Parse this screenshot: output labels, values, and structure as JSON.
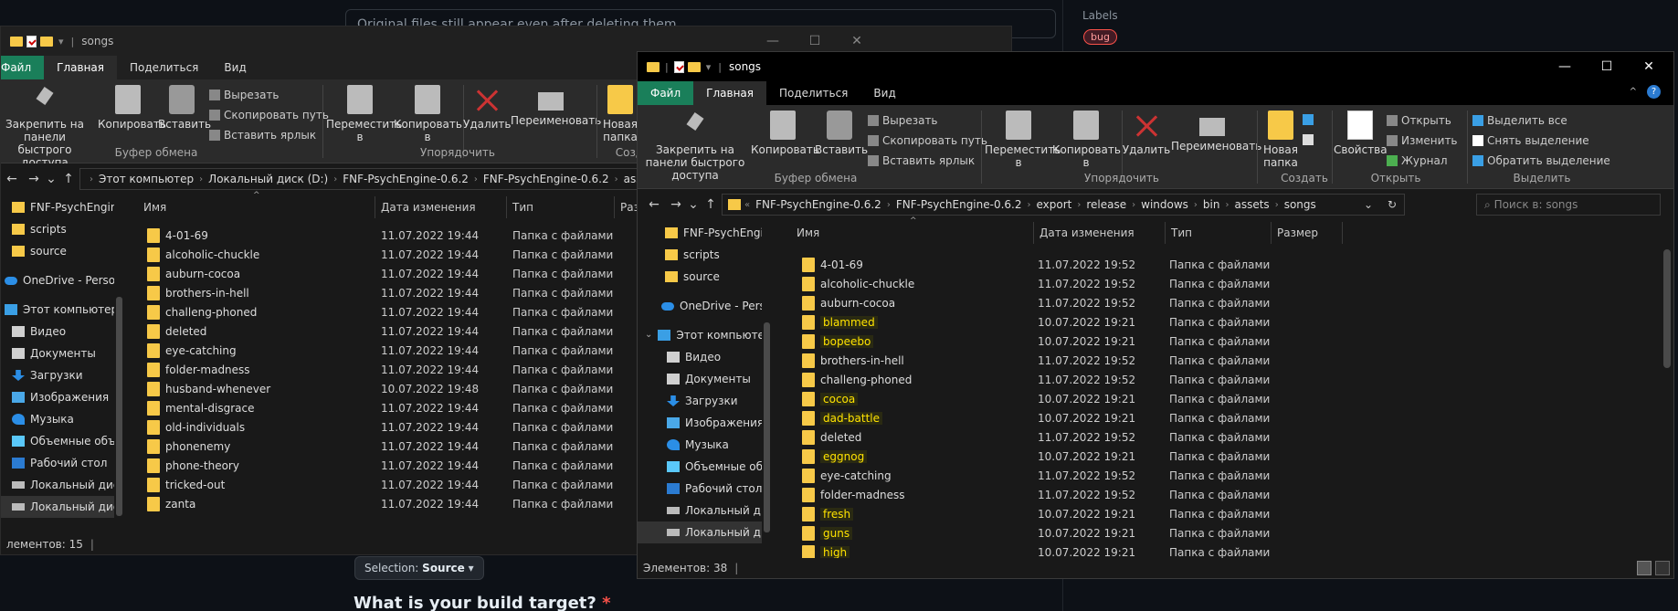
{
  "github": {
    "title_text": "Original files still appear even after deleting them",
    "labels_heading": "Labels",
    "bug_label": "bug",
    "selection_prefix": "Selection:",
    "selection_value": "Source",
    "question_text": "What is your build target?",
    "required_marker": "*"
  },
  "window1": {
    "title": "songs",
    "tabs": [
      "Файл",
      "Главная",
      "Поделиться",
      "Вид"
    ],
    "ribbon": {
      "pin_label": "Закрепить на панели быстрого доступа",
      "copy_label": "Копировать",
      "paste_label": "Вставить",
      "cut_label": "Вырезать",
      "copy_path_label": "Скопировать путь",
      "paste_shortcut_label": "Вставить ярлык",
      "clipboard_group": "Буфер обмена",
      "move_to_label": "Переместить в",
      "copy_to_label": "Копировать в",
      "delete_label": "Удалить",
      "rename_label": "Переименовать",
      "organize_group": "Упорядочить",
      "new_folder_label": "Новая папка",
      "create_group": "Созд"
    },
    "breadcrumbs": [
      "Этот компьютер",
      "Локальный диск (D:)",
      "FNF-PsychEngine-0.6.2",
      "FNF-PsychEngine-0.6.2",
      "assets"
    ],
    "nav_items": [
      "FNF-PsychEngin",
      "scripts",
      "source",
      "OneDrive - Persor",
      "Этот компьютер",
      "Видео",
      "Документы",
      "Загрузки",
      "Изображения",
      "Музыка",
      "Объемные объ",
      "Рабочий стол",
      "Локальный дис",
      "Локальный дис"
    ],
    "columns": [
      "Имя",
      "Дата изменения",
      "Тип",
      "Раз"
    ],
    "rows": [
      {
        "name": "4-01-69",
        "date": "11.07.2022 19:44",
        "type": "Папка с файлами"
      },
      {
        "name": "alcoholic-chuckle",
        "date": "11.07.2022 19:44",
        "type": "Папка с файлами"
      },
      {
        "name": "auburn-cocoa",
        "date": "11.07.2022 19:44",
        "type": "Папка с файлами"
      },
      {
        "name": "brothers-in-hell",
        "date": "11.07.2022 19:44",
        "type": "Папка с файлами"
      },
      {
        "name": "challeng-phoned",
        "date": "11.07.2022 19:44",
        "type": "Папка с файлами"
      },
      {
        "name": "deleted",
        "date": "11.07.2022 19:44",
        "type": "Папка с файлами"
      },
      {
        "name": "eye-catching",
        "date": "11.07.2022 19:44",
        "type": "Папка с файлами"
      },
      {
        "name": "folder-madness",
        "date": "11.07.2022 19:44",
        "type": "Папка с файлами"
      },
      {
        "name": "husband-whenever",
        "date": "10.07.2022 19:48",
        "type": "Папка с файлами"
      },
      {
        "name": "mental-disgrace",
        "date": "11.07.2022 19:44",
        "type": "Папка с файлами"
      },
      {
        "name": "old-individuals",
        "date": "11.07.2022 19:44",
        "type": "Папка с файлами"
      },
      {
        "name": "phonenemy",
        "date": "11.07.2022 19:44",
        "type": "Папка с файлами"
      },
      {
        "name": "phone-theory",
        "date": "11.07.2022 19:44",
        "type": "Папка с файлами"
      },
      {
        "name": "tricked-out",
        "date": "11.07.2022 19:44",
        "type": "Папка с файлами"
      },
      {
        "name": "zanta",
        "date": "11.07.2022 19:44",
        "type": "Папка с файлами"
      }
    ],
    "status": "лементов: 15"
  },
  "window2": {
    "title": "songs",
    "tabs": [
      "Файл",
      "Главная",
      "Поделиться",
      "Вид"
    ],
    "ribbon": {
      "pin_label": "Закрепить на панели быстрого доступа",
      "copy_label": "Копировать",
      "paste_label": "Вставить",
      "cut_label": "Вырезать",
      "copy_path_label": "Скопировать путь",
      "paste_shortcut_label": "Вставить ярлык",
      "clipboard_group": "Буфер обмена",
      "move_to_label": "Переместить в",
      "copy_to_label": "Копировать в",
      "delete_label": "Удалить",
      "rename_label": "Переименовать",
      "organize_group": "Упорядочить",
      "new_folder_label": "Новая папка",
      "create_group": "Создать",
      "properties_label": "Свойства",
      "open_label": "Открыть",
      "edit_label": "Изменить",
      "history_label": "Журнал",
      "open_group": "Открыть",
      "select_all_label": "Выделить все",
      "select_none_label": "Снять выделение",
      "invert_label": "Обратить выделение",
      "select_group": "Выделить"
    },
    "breadcrumbs": [
      "FNF-PsychEngine-0.6.2",
      "FNF-PsychEngine-0.6.2",
      "export",
      "release",
      "windows",
      "bin",
      "assets",
      "songs"
    ],
    "search_placeholder": "Поиск в: songs",
    "nav_items": [
      "FNF-PsychEngin",
      "scripts",
      "source",
      "OneDrive - Persor",
      "Этот компьютер",
      "Видео",
      "Документы",
      "Загрузки",
      "Изображения",
      "Музыка",
      "Объемные объ",
      "Рабочий стол",
      "Локальный дис",
      "Локальный дис"
    ],
    "columns": [
      "Имя",
      "Дата изменения",
      "Тип",
      "Размер"
    ],
    "rows": [
      {
        "name": "4-01-69",
        "date": "11.07.2022 19:52",
        "type": "Папка с файлами",
        "highlight": false
      },
      {
        "name": "alcoholic-chuckle",
        "date": "11.07.2022 19:52",
        "type": "Папка с файлами",
        "highlight": false
      },
      {
        "name": "auburn-cocoa",
        "date": "11.07.2022 19:52",
        "type": "Папка с файлами",
        "highlight": false
      },
      {
        "name": "blammed",
        "date": "10.07.2022 19:21",
        "type": "Папка с файлами",
        "highlight": true
      },
      {
        "name": "bopeebo",
        "date": "10.07.2022 19:21",
        "type": "Папка с файлами",
        "highlight": true
      },
      {
        "name": "brothers-in-hell",
        "date": "11.07.2022 19:52",
        "type": "Папка с файлами",
        "highlight": false
      },
      {
        "name": "challeng-phoned",
        "date": "11.07.2022 19:52",
        "type": "Папка с файлами",
        "highlight": false
      },
      {
        "name": "cocoa",
        "date": "10.07.2022 19:21",
        "type": "Папка с файлами",
        "highlight": true
      },
      {
        "name": "dad-battle",
        "date": "10.07.2022 19:21",
        "type": "Папка с файлами",
        "highlight": true
      },
      {
        "name": "deleted",
        "date": "11.07.2022 19:52",
        "type": "Папка с файлами",
        "highlight": false
      },
      {
        "name": "eggnog",
        "date": "10.07.2022 19:21",
        "type": "Папка с файлами",
        "highlight": true
      },
      {
        "name": "eye-catching",
        "date": "11.07.2022 19:52",
        "type": "Папка с файлами",
        "highlight": false
      },
      {
        "name": "folder-madness",
        "date": "11.07.2022 19:52",
        "type": "Папка с файлами",
        "highlight": false
      },
      {
        "name": "fresh",
        "date": "10.07.2022 19:21",
        "type": "Папка с файлами",
        "highlight": true
      },
      {
        "name": "guns",
        "date": "10.07.2022 19:21",
        "type": "Папка с файлами",
        "highlight": true
      },
      {
        "name": "high",
        "date": "10.07.2022 19:21",
        "type": "Папка с файлами",
        "highlight": true
      }
    ],
    "status": "Элементов: 38"
  }
}
